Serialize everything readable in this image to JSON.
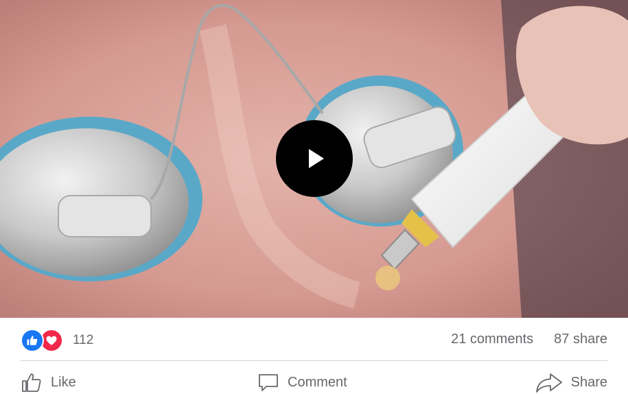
{
  "video": {
    "play_icon": "play-icon"
  },
  "reactions": {
    "icons": [
      "like-reaction-icon",
      "love-reaction-icon"
    ],
    "count": "112",
    "like_color": "#1877f2",
    "love_color": "#f0284a"
  },
  "stats": {
    "comments": "21 comments",
    "shares": "87 share"
  },
  "actions": {
    "like": "Like",
    "comment": "Comment",
    "share": "Share"
  }
}
